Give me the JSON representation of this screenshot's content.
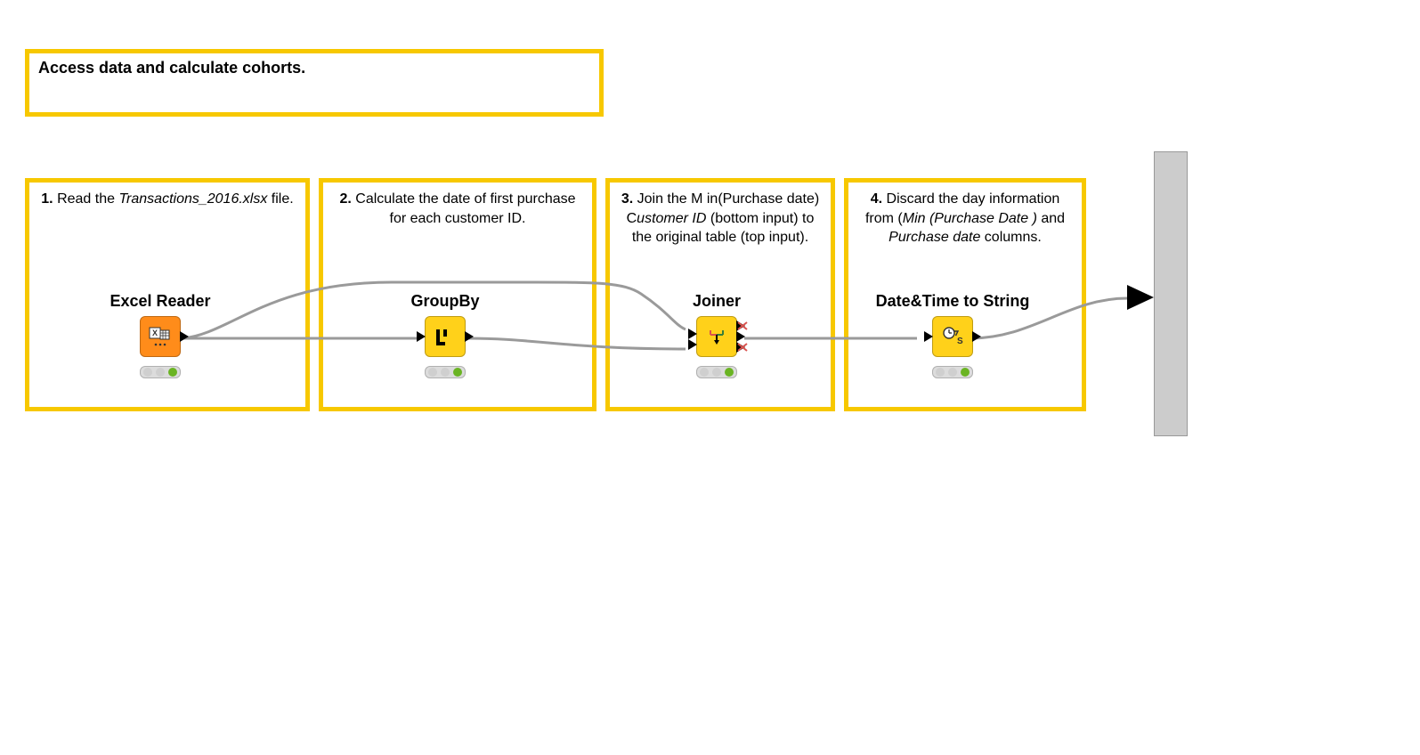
{
  "header": {
    "title": "Access data and calculate cohorts."
  },
  "steps": [
    {
      "num": "1.",
      "desc_pre": " Read the  ",
      "italic": "Transactions_2016.xlsx",
      "desc_post": "  file."
    },
    {
      "num": "2.",
      "desc_pre": " Calculate the date of first purchase for each customer ID.",
      "italic": "",
      "desc_post": ""
    },
    {
      "num": "3.",
      "desc_pre": " Join the M in(Purchase date) C",
      "italic": "ustomer ID",
      "desc_post": "  (bottom input) to the original table (top input)."
    },
    {
      "num": "4.",
      "desc_pre": "  Discard the day information from (",
      "italic": "Min (Purchase Date )",
      "desc_post": " and ",
      "italic2": "Purchase date",
      "desc_post2": "  columns."
    }
  ],
  "nodes": [
    {
      "label": "Excel Reader"
    },
    {
      "label": "GroupBy"
    },
    {
      "label": "Joiner"
    },
    {
      "label": "Date&Time to String"
    }
  ]
}
